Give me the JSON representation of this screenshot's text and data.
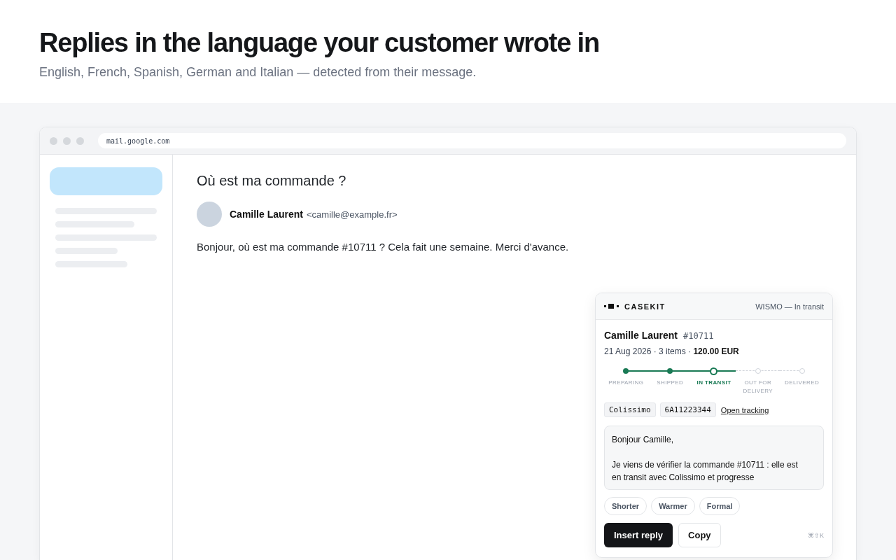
{
  "hero": {
    "title": "Replies in the language your customer wrote in",
    "subtitle": "English, French, Spanish, German and Italian — detected from their message."
  },
  "browser": {
    "url": "mail.google.com"
  },
  "email": {
    "subject": "Où est ma commande ?",
    "sender_name": "Camille Laurent",
    "sender_email": "<camille@example.fr>",
    "body": "Bonjour, où est ma commande #10711 ? Cela fait une semaine. Merci d'avance."
  },
  "panel": {
    "brand": "CASEKIT",
    "status": "WISMO — In transit",
    "customer": "Camille Laurent",
    "order": "#10711",
    "meta": "21 Aug 2026 · 3 items · **120.00 EUR**",
    "steps": [
      {
        "label": "PREPARING",
        "done": true,
        "current": false
      },
      {
        "label": "SHIPPED",
        "done": true,
        "current": false
      },
      {
        "label": "IN TRANSIT",
        "done": false,
        "current": true
      },
      {
        "label": "OUT FOR DELIVERY",
        "done": false,
        "current": false
      },
      {
        "label": "DELIVERED",
        "done": false,
        "current": false
      }
    ],
    "carrier": "Colissimo",
    "tracking_number": "6A11223344",
    "tracking_link": "Open tracking",
    "reply": [
      "Bonjour Camille,",
      "Je viens de vérifier la commande #10711 : elle est en transit avec Colissimo et progresse"
    ],
    "tones": [
      "Shorter",
      "Warmer",
      "Formal"
    ],
    "primary_button": "Insert reply",
    "secondary_button": "Copy",
    "shortcut": "⌘⇧K"
  }
}
